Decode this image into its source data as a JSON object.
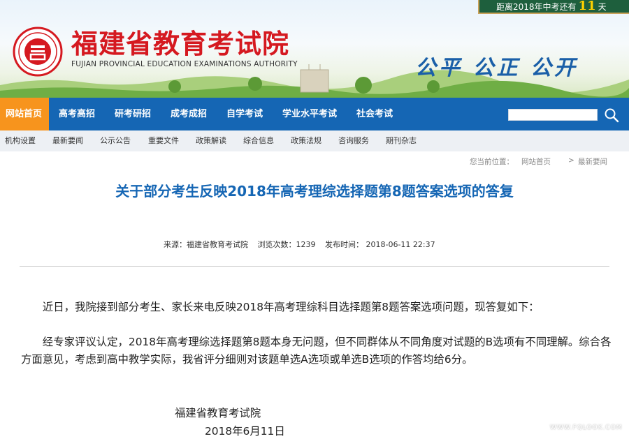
{
  "countdown": {
    "prefix": "距离2018年中考还有",
    "days": "11",
    "suffix": "天"
  },
  "site": {
    "name": "福建省教育考试院",
    "name_en": "FUJIAN PROVINCIAL EDUCATION EXAMINATIONS AUTHORITY",
    "slogan": "公平 公正 公开"
  },
  "nav": {
    "items": [
      "网站首页",
      "高考高招",
      "研考研招",
      "成考成招",
      "自学考试",
      "学业水平考试",
      "社会考试"
    ],
    "search_placeholder": ""
  },
  "subnav": {
    "items": [
      "机构设置",
      "最新要闻",
      "公示公告",
      "重要文件",
      "政策解读",
      "综合信息",
      "政策法规",
      "咨询服务",
      "期刊杂志"
    ]
  },
  "breadcrumb": {
    "label": "您当前位置：",
    "home": "网站首页",
    "sep": ">",
    "current": "最新要闻"
  },
  "article": {
    "title": "关于部分考生反映2018年高考理综选择题第8题答案选项的答复",
    "source": "来源：福建省教育考试院",
    "views": "浏览次数：1239",
    "published": "发布时间： 2018-06-11 22:37",
    "paragraphs": [
      "近日，我院接到部分考生、家长来电反映2018年高考理综科目选择题第8题答案选项问题，现答复如下：",
      "经专家评议认定，2018年高考理综选择题第8题本身无问题，但不同群体从不同角度对试题的B选项有不同理解。综合各方面意见，考虑到高中教学实际，我省评分细则对该题单选A选项或单选B选项的作答均给6分。"
    ],
    "signature_org": "福建省教育考试院",
    "signature_date": "2018年6月11日"
  },
  "watermark": {
    "text": "看福清",
    "url": "WWW.FQLOOK.COM"
  },
  "colors": {
    "brand_red": "#d51920",
    "nav_blue": "#1566b4",
    "nav_active": "#f7941d",
    "title_blue": "#1566b4"
  }
}
